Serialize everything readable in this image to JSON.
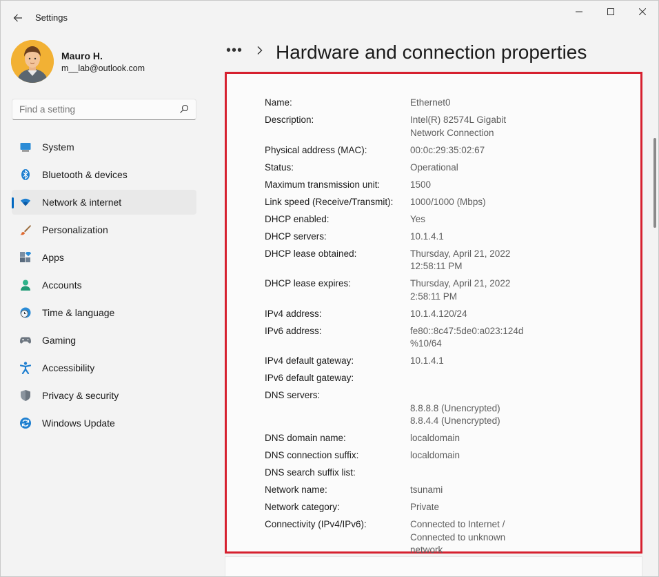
{
  "window": {
    "app_title": "Settings"
  },
  "profile": {
    "name": "Mauro H.",
    "email": "m__lab@outlook.com"
  },
  "search": {
    "placeholder": "Find a setting"
  },
  "nav": {
    "items": [
      {
        "label": "System",
        "icon": "system-icon"
      },
      {
        "label": "Bluetooth & devices",
        "icon": "bluetooth-icon"
      },
      {
        "label": "Network & internet",
        "icon": "wifi-icon",
        "active": true
      },
      {
        "label": "Personalization",
        "icon": "brush-icon"
      },
      {
        "label": "Apps",
        "icon": "apps-icon"
      },
      {
        "label": "Accounts",
        "icon": "person-icon"
      },
      {
        "label": "Time & language",
        "icon": "clock-globe-icon"
      },
      {
        "label": "Gaming",
        "icon": "gamepad-icon"
      },
      {
        "label": "Accessibility",
        "icon": "accessibility-icon"
      },
      {
        "label": "Privacy & security",
        "icon": "shield-icon"
      },
      {
        "label": "Windows Update",
        "icon": "update-icon"
      }
    ]
  },
  "breadcrumb": {
    "more": "•••",
    "title": "Hardware and connection properties"
  },
  "properties": [
    {
      "label": "Name:",
      "value": "Ethernet0"
    },
    {
      "label": "Description:",
      "value": "Intel(R) 82574L Gigabit\nNetwork Connection"
    },
    {
      "label": "Physical address (MAC):",
      "value": "00:0c:29:35:02:67"
    },
    {
      "label": "Status:",
      "value": "Operational"
    },
    {
      "label": "Maximum transmission unit:",
      "value": "1500"
    },
    {
      "label": "Link speed (Receive/Transmit):",
      "value": "1000/1000 (Mbps)"
    },
    {
      "label": "DHCP enabled:",
      "value": "Yes"
    },
    {
      "label": "DHCP servers:",
      "value": "10.1.4.1"
    },
    {
      "label": "DHCP lease obtained:",
      "value": "Thursday, April 21, 2022\n12:58:11 PM"
    },
    {
      "label": "DHCP lease expires:",
      "value": "Thursday, April 21, 2022\n2:58:11 PM"
    },
    {
      "label": "IPv4 address:",
      "value": "10.1.4.120/24"
    },
    {
      "label": "IPv6 address:",
      "value": "fe80::8c47:5de0:a023:124d\n%10/64"
    },
    {
      "label": "IPv4 default gateway:",
      "value": "10.1.4.1"
    },
    {
      "label": "IPv6 default gateway:",
      "value": ""
    },
    {
      "label": "DNS servers:",
      "value": "\n8.8.8.8 (Unencrypted)\n8.8.4.4 (Unencrypted)"
    },
    {
      "label": "DNS domain name:",
      "value": "localdomain"
    },
    {
      "label": "DNS connection suffix:",
      "value": "localdomain"
    },
    {
      "label": "DNS search suffix list:",
      "value": ""
    },
    {
      "label": "Network name:",
      "value": "tsunami"
    },
    {
      "label": "Network category:",
      "value": "Private"
    },
    {
      "label": "Connectivity (IPv4/IPv6):",
      "value": "Connected to Internet /\nConnected to unknown\nnetwork"
    }
  ],
  "colors": {
    "accent": "#0067c0",
    "highlight_border": "#d6202f"
  }
}
